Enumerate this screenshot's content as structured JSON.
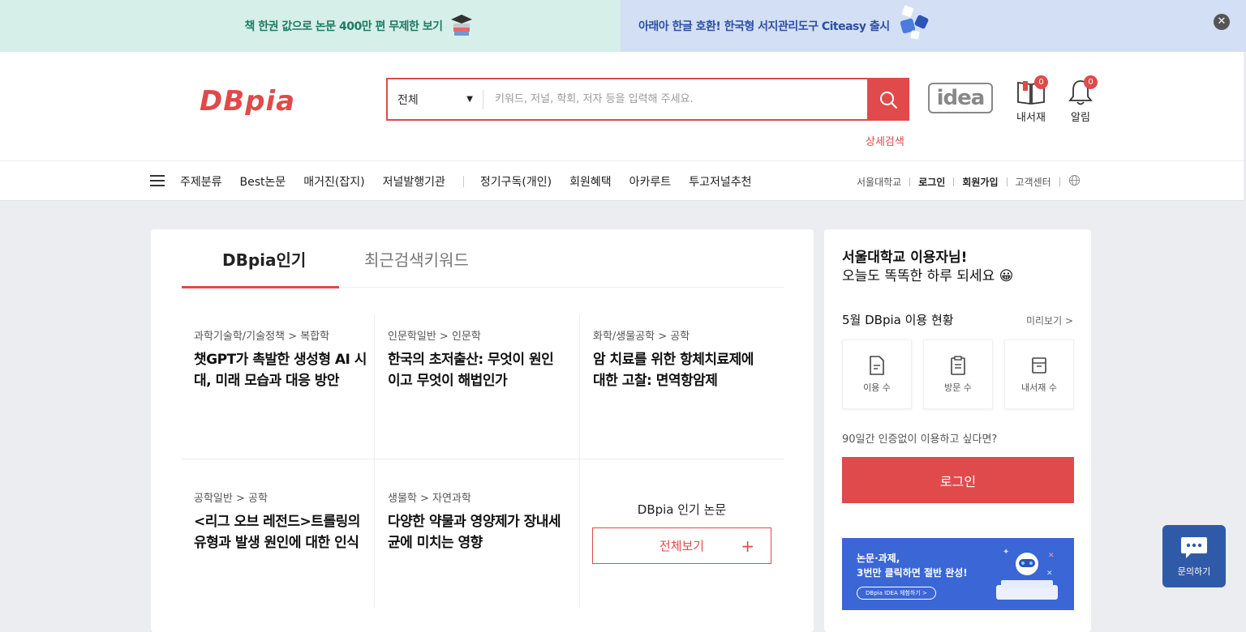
{
  "banner": {
    "left_text": "책 한권 값으로 논문 400만 편 무제한 보기",
    "right_text": "아래아 한글 호환! 한국형 서지관리도구 Citeasy 출시",
    "close_symbol": "✕",
    "colors": {
      "left_bg": "#d6efe9",
      "right_bg": "#d3dff4"
    }
  },
  "header": {
    "logo_text": "DBpia",
    "search": {
      "scope_selected": "전체",
      "placeholder": "키워드, 저널, 학회, 저자 등을 입력해 주세요.",
      "value": ""
    },
    "advanced_search_label": "상세검색",
    "idea_label": "idea",
    "library": {
      "label": "내서재",
      "count": "0"
    },
    "alerts": {
      "label": "알림",
      "count": "0"
    }
  },
  "nav": {
    "items": [
      "주제분류",
      "Best논문",
      "매거진(잡지)",
      "저널발행기관"
    ],
    "items2": [
      "정기구독(개인)",
      "회원혜택",
      "아카루트",
      "투고저널추천"
    ],
    "right": {
      "institution": "서울대학교",
      "login": "로그인",
      "signup": "회원가입",
      "support": "고객센터"
    }
  },
  "popular": {
    "tabs": {
      "active": "DBpia인기",
      "inactive": "최근검색키워드"
    },
    "papers": [
      {
        "category": "과학기술학/기술정책 > 복합학",
        "title": "챗GPT가 촉발한 생성형 AI 시대, 미래 모습과 대응 방안"
      },
      {
        "category": "인문학일반 > 인문학",
        "title": "한국의 초저출산: 무엇이 원인이고 무엇이 해법인가"
      },
      {
        "category": "화학/생물공학 > 공학",
        "title": "암 치료를 위한 항체치료제에 대한 고찰: 면역항암제"
      },
      {
        "category": "공학일반 > 공학",
        "title": "<리그 오브 레전드>트롤링의 유형과 발생 원인에 대한 인식"
      },
      {
        "category": "생물학 > 자연과학",
        "title": "다양한 약물과 영양제가 장내세균에 미치는 영향"
      }
    ],
    "more": {
      "label": "DBpia 인기 논문",
      "button": "전체보기",
      "plus": "+"
    }
  },
  "sidebar": {
    "greeting_line1": "서울대학교 이용자님!",
    "greeting_line2": "오늘도 똑똑한 하루 되세요 😀",
    "usage_title": "5월 DBpia 이용 현황",
    "preview_label": "미리보기 >",
    "stats": [
      "이용 수",
      "방문 수",
      "내서재 수"
    ],
    "no_auth_text": "90일간 인증없이 이용하고 싶다면?",
    "login_button": "로그인",
    "promo": {
      "line1": "논문·과제,",
      "line2": "3번만 클릭하면 절반 완성!",
      "pill": "DBpia IDEA 체험하기 >"
    }
  },
  "chat": {
    "label": "문의하기"
  },
  "theme": {
    "accent": "#e04a4a",
    "chat_bg": "#2f5aa8",
    "promo_bg": "#3a66d6"
  }
}
